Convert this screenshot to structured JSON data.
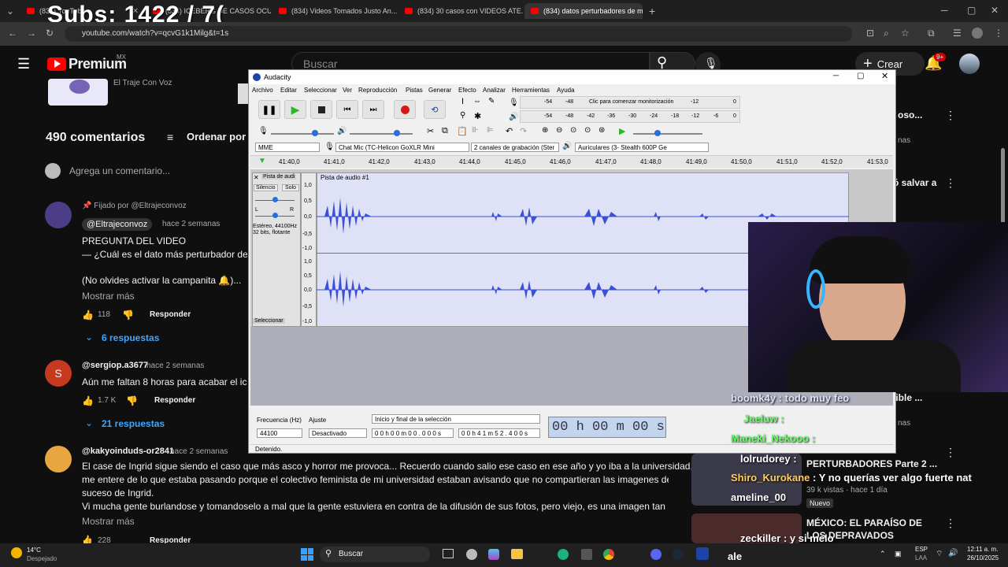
{
  "browser": {
    "tabs": [
      {
        "label": "(834) YouTube"
      },
      {
        "label": "(834) ICEBERG DE CASOS OCU..."
      },
      {
        "label": "(834) Videos Tomados Justo An..."
      },
      {
        "label": "(834) 30 casos con VIDEOS ATE..."
      },
      {
        "label": "(834) datos perturbadores de m..."
      }
    ],
    "url": "youtube.com/watch?v=qcvG1k1Milg&t=1s",
    "overlay": "Subs: 1422 / 7("
  },
  "youtube": {
    "logo": "Premium",
    "region": "MX",
    "search_placeholder": "Buscar",
    "create_label": "Crear",
    "notif_badge": "9+",
    "channel_caption": "El Traje Con Voz",
    "comments_count": "490 comentarios",
    "sort_label": "Ordenar por",
    "add_comment": "Agrega un comentario...",
    "comments": [
      {
        "pinned": "Fijado por @Eltrajeconvoz",
        "author": "@Eltrajeconvoz",
        "time": "hace 2 semanas",
        "lines": [
          "PREGUNTA DEL VIDEO",
          "— ¿Cuál es el dato más perturbador de N",
          "",
          "(No olvides activar la campanita 🔔)..."
        ],
        "more": "Mostrar más",
        "likes": "118",
        "reply": "Responder",
        "replies": "6 respuestas"
      },
      {
        "avatar": "S",
        "author": "@sergiop.a3677",
        "time": "hace 2 semanas",
        "lines": [
          "Aún me faltan 8 horas para acabar el icel"
        ],
        "likes": "1.7 K",
        "reply": "Responder",
        "replies": "21 respuestas"
      },
      {
        "author": "@kakyoinduds-or2841",
        "time": "hace 2 semanas",
        "lines": [
          "El case de Ingrid sigue siendo el caso que más asco y horror me provoca... Recuerdo cuando salio ese caso en ese año y yo iba a la universidad,",
          "me entere de lo que estaba pasando porque el colectivo feminista de mi universidad estaban avisando que no compartieran las imagenes del",
          "suceso de Ingrid.",
          "Vi mucha gente burlandose y tomandoselo a mal que la gente estuviera en contra de la difusión de sus fotos, pero viejo, es una imagen tan ..."
        ],
        "more": "Mostrar más",
        "likes": "228",
        "reply": "Responder"
      }
    ],
    "sidebar": [
      {
        "title": "oso...",
        "meta": "nas"
      },
      {
        "title": "ó salvar a",
        "meta": ""
      },
      {
        "title": "rrible ...",
        "meta": "nas"
      },
      {
        "title": "PERTURBADORES Parte 2 ...",
        "meta": "39 k vistas · hace 1 día",
        "badge": "Nuevo"
      },
      {
        "title": "MÉXICO: EL PARAÍSO DE LOS DEPRAVADOS",
        "meta": ""
      }
    ]
  },
  "audacity": {
    "title": "Audacity",
    "menu": [
      "Archivo",
      "Editar",
      "Seleccionar",
      "Ver",
      "Reproducción",
      "Pistas",
      "Generar",
      "Efecto",
      "Analizar",
      "Herramientas",
      "Ayuda"
    ],
    "meter_prompt": "Clic para comenzar monitorización",
    "meter_ticks": [
      "-54",
      "-48",
      "-12",
      "0"
    ],
    "meter_ticks2": [
      "-54",
      "-48",
      "-42",
      "-36",
      "-30",
      "-24",
      "-18",
      "-12",
      "-6",
      "0"
    ],
    "host": "MME",
    "mic": "Chat Mic (TC-Helicon GoXLR Mini",
    "channels": "2 canales de grabación (Ster",
    "output": "Auriculares (3- Stealth 600P Ge",
    "timeline": [
      "41:40,0",
      "41:41,0",
      "41:42,0",
      "41:43,0",
      "41:44,0",
      "41:45,0",
      "41:46,0",
      "41:47,0",
      "41:48,0",
      "41:49,0",
      "41:50,0",
      "41:51,0",
      "41:52,0",
      "41:53,0"
    ],
    "track_name": "Pista de audi",
    "track_title": "Pista de audio #1",
    "mute": "Silencio",
    "solo": "Solo",
    "track_info": "Estéreo, 44100Hz",
    "track_info2": "32 bits, flotante",
    "select": "Seleccionar",
    "scale": [
      "1,0",
      "0,5",
      "0,0",
      "-0,5",
      "-1,0"
    ],
    "rate_label": "Frecuencia (Hz)",
    "rate": "44100",
    "snap_label": "Ajuste",
    "snap": "Desactivado",
    "sel_label": "Inicio y final de la selección",
    "sel_start": "0 0 h 0 0 m 0 0 . 0 0 0 s",
    "sel_end": "0 0 h 4 1 m 5 2 . 4 0 0 s",
    "big_time": "00 h 00 m 00 s",
    "status": "Detenido."
  },
  "chat": [
    {
      "user": "boomk4y",
      "text": ": todo muy feo",
      "color": "#e0e0ff"
    },
    {
      "user": "Jaeluw",
      "text": ":",
      "color": "#66ff66"
    },
    {
      "user": "Maneki_Nekooo",
      "text": ":",
      "color": "#66ff66"
    },
    {
      "user": "lolrudorey",
      "text": ":",
      "color": "#ffffff"
    },
    {
      "user": "Shiro_Kurokane",
      "text": ": Y no querías ver algo fuerte nat",
      "color": "#ffcc66"
    },
    {
      "user": "ameline_00",
      "text": "",
      "color": "#ffffff"
    },
    {
      "user": "zeckiller",
      "text": ": y si melo",
      "color": "#ffffff"
    },
    {
      "user": "ale",
      "text": "",
      "color": "#ffffff"
    }
  ],
  "taskbar": {
    "weather_temp": "14°C",
    "weather_desc": "Despejado",
    "search": "Buscar",
    "lang1": "ESP",
    "lang2": "LAA",
    "time": "12:11 a. m.",
    "date": "26/10/2025"
  },
  "colors": {
    "yt_red": "#ff0000",
    "link_blue": "#3ea6ff",
    "wave": "#3b4fd8",
    "track_bg": "#dfe2f7"
  }
}
